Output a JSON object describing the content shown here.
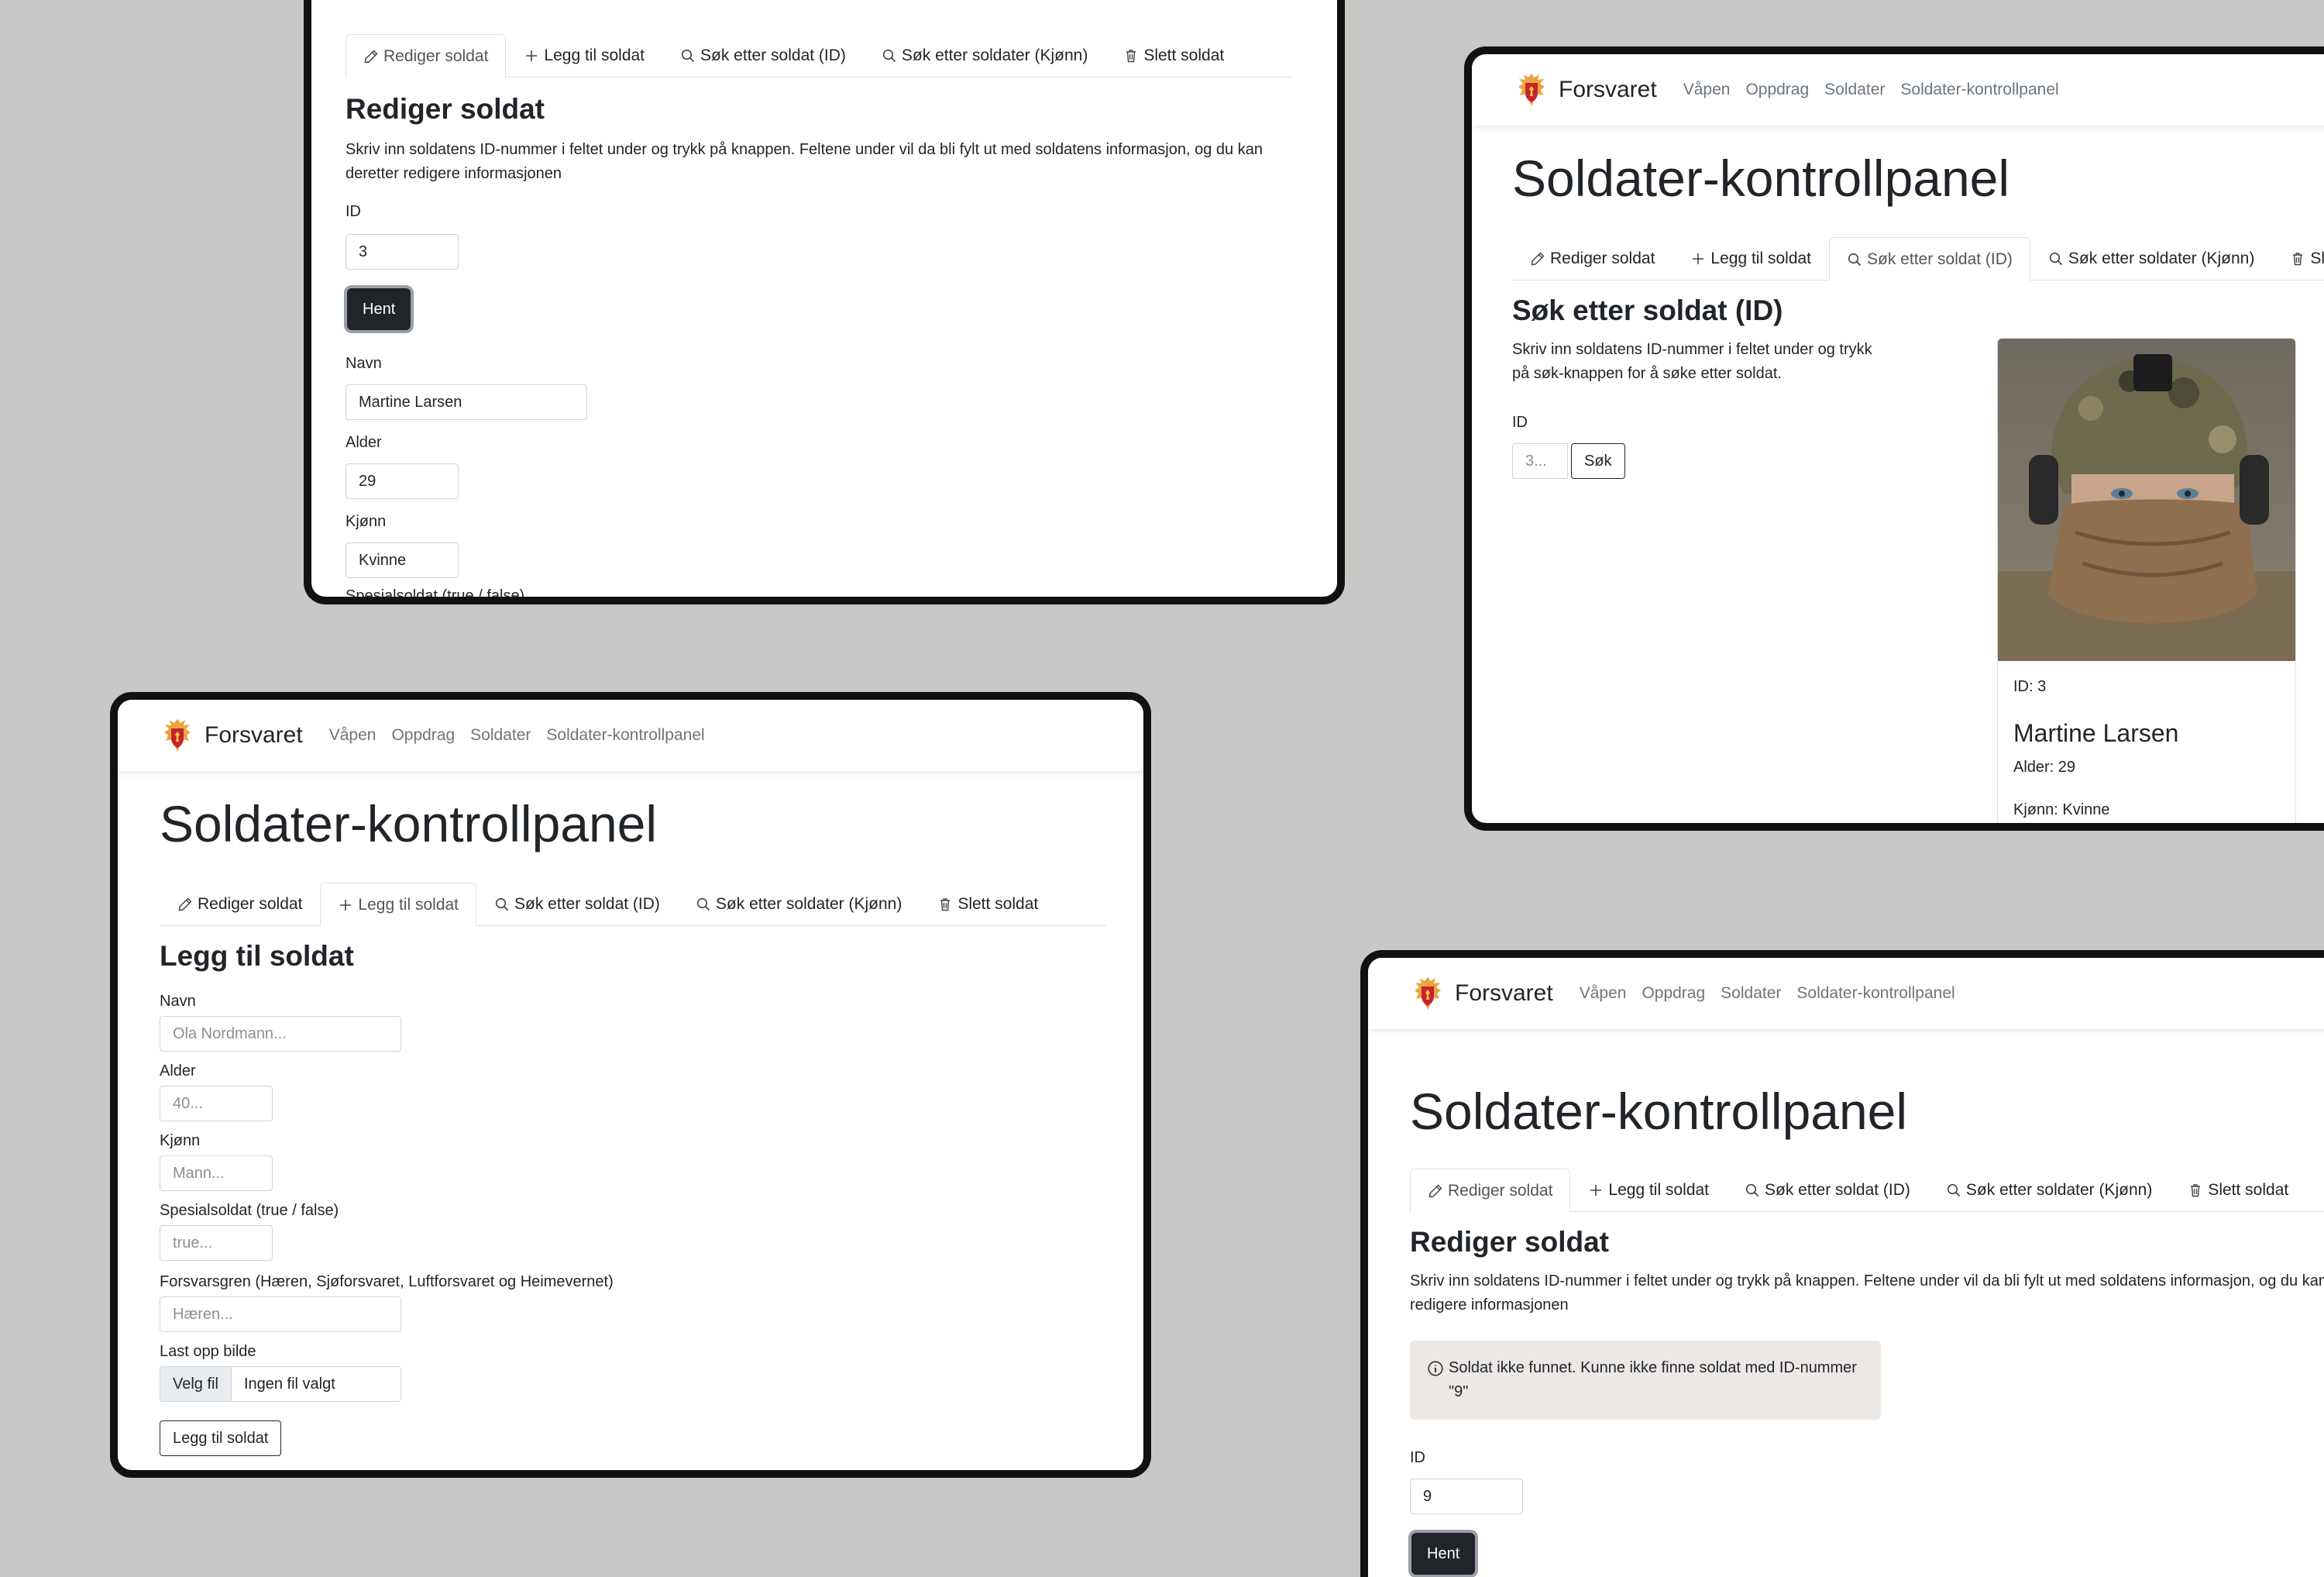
{
  "nav": {
    "brand": "Forsvaret",
    "links": [
      "Våpen",
      "Oppdrag",
      "Soldater",
      "Soldater-kontrollpanel"
    ]
  },
  "page_title": "Soldater-kontrollpanel",
  "tabs": {
    "edit": "Rediger soldat",
    "add": "Legg til soldat",
    "search_id": "Søk etter soldat (ID)",
    "search_gender": "Søk etter soldater (Kjønn)",
    "delete": "Slett soldat"
  },
  "tab_icons": [
    "pencil-icon",
    "plus-icon",
    "search-icon",
    "search-icon",
    "trash-icon"
  ],
  "edit_view": {
    "title": "Rediger soldat",
    "description": "Skriv inn soldatens ID-nummer i feltet under og trykk på knappen. Feltene under vil da bli fylt ut med soldatens informasjon, og du kan deretter redigere informasjonen",
    "id_label": "ID",
    "id_value": "3",
    "fetch_button": "Hent",
    "name_label": "Navn",
    "name_value": "Martine Larsen",
    "age_label": "Alder",
    "age_value": "29",
    "gender_label": "Kjønn",
    "gender_value": "Kvinne",
    "special_label": "Spesialsoldat (true / false)"
  },
  "search_view": {
    "title": "Søk etter soldat (ID)",
    "description": "Skriv inn soldatens ID-nummer i feltet under og trykk på søk-knappen for å søke etter soldat.",
    "id_label": "ID",
    "id_placeholder": "3...",
    "search_button": "Søk",
    "result": {
      "id_line": "ID: 3",
      "name": "Martine Larsen",
      "age_line": "Alder: 29",
      "gender_line": "Kjønn: Kvinne"
    }
  },
  "add_view": {
    "title": "Legg til soldat",
    "name_label": "Navn",
    "name_placeholder": "Ola Nordmann...",
    "age_label": "Alder",
    "age_placeholder": "40...",
    "gender_label": "Kjønn",
    "gender_placeholder": "Mann...",
    "special_label": "Spesialsoldat (true / false)",
    "special_placeholder": "true...",
    "branch_label": "Forsvarsgren (Hæren, Sjøforsvaret, Luftforsvaret og Heimevernet)",
    "branch_placeholder": "Hæren...",
    "upload_label": "Last opp bilde",
    "file_button": "Velg fil",
    "file_status": "Ingen fil valgt",
    "submit_button": "Legg til soldat"
  },
  "edit_error_view": {
    "title": "Rediger soldat",
    "description": "Skriv inn soldatens ID-nummer i feltet under og trykk på knappen. Feltene under vil da bli fylt ut med soldatens informasjon, og du kan deretter redigere informasjonen",
    "alert": "Soldat ikke funnet. Kunne ikke finne soldat med ID-nummer \"9\"",
    "id_label": "ID",
    "id_value": "9",
    "fetch_button": "Hent"
  }
}
